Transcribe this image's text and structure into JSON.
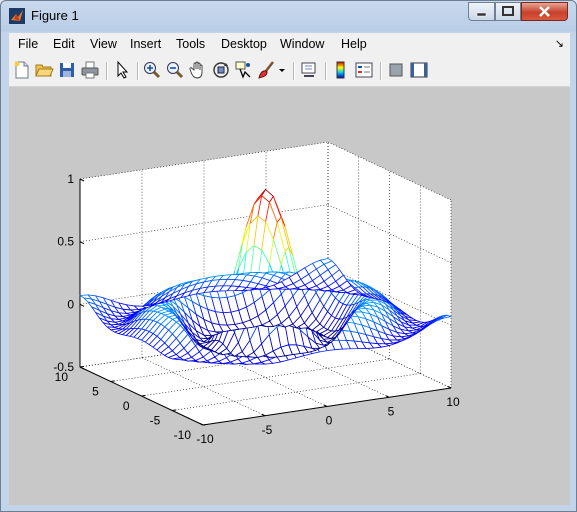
{
  "window": {
    "title": "Figure 1"
  },
  "menu": [
    "File",
    "Edit",
    "View",
    "Insert",
    "Tools",
    "Desktop",
    "Window",
    "Help"
  ],
  "menu_overflow_icon": "dock-arrow-icon",
  "toolbar": [
    "new-figure-icon",
    "open-file-icon",
    "save-icon",
    "print-icon",
    "edit-plot-arrow-icon",
    "zoom-in-icon",
    "zoom-out-icon",
    "pan-hand-icon",
    "rotate-3d-icon",
    "data-cursor-icon",
    "brush-icon",
    "brush-dropdown-icon",
    "link-plot-icon",
    "insert-colorbar-icon",
    "insert-legend-icon",
    "hide-plot-tools-icon",
    "show-plot-tools-icon"
  ],
  "chart_data": {
    "type": "mesh3d",
    "function": "z = sin(r)/r, r = sqrt(x^2 + y^2)",
    "x": {
      "range": [
        -10,
        10
      ],
      "ticks": [
        "-10",
        "-5",
        "0",
        "5",
        "10"
      ]
    },
    "y": {
      "range": [
        -10,
        10
      ],
      "ticks": [
        "-10",
        "-5",
        "0",
        "5",
        "10"
      ]
    },
    "z": {
      "range": [
        -0.5,
        1
      ],
      "ticks": [
        "-0.5",
        "0",
        "0.5",
        "1"
      ]
    },
    "grid": true,
    "colormap": "jet",
    "view": "default 3-D"
  }
}
